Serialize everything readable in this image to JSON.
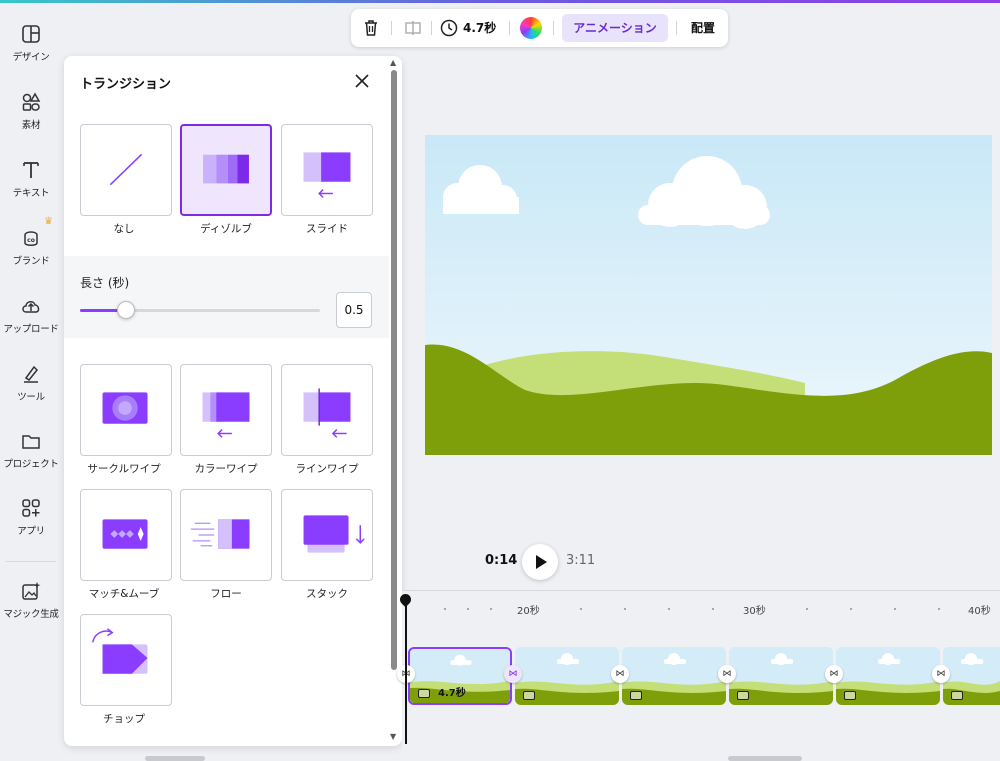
{
  "sidebar": {
    "items": [
      {
        "label": "デザイン",
        "icon": "layout-icon"
      },
      {
        "label": "素材",
        "icon": "shapes-icon"
      },
      {
        "label": "テキスト",
        "icon": "text-icon"
      },
      {
        "label": "ブランド",
        "icon": "brand-icon"
      },
      {
        "label": "アップロード",
        "icon": "cloud-upload-icon"
      },
      {
        "label": "ツール",
        "icon": "pen-tool-icon"
      },
      {
        "label": "プロジェクト",
        "icon": "folder-icon"
      },
      {
        "label": "アプリ",
        "icon": "apps-grid-icon"
      },
      {
        "label": "マジック生成",
        "icon": "magic-image-icon"
      }
    ]
  },
  "toolbar": {
    "duration": "4.7秒",
    "animation_label": "アニメーション",
    "position_label": "配置"
  },
  "panel": {
    "title": "トランジション",
    "duration_label": "長さ (秒)",
    "duration_value": "0.5",
    "duration_fraction": 0.19,
    "transitions": [
      {
        "label": "なし"
      },
      {
        "label": "ディゾルブ",
        "selected": true
      },
      {
        "label": "スライド"
      },
      {
        "label": "サークルワイプ"
      },
      {
        "label": "カラーワイプ"
      },
      {
        "label": "ラインワイプ"
      },
      {
        "label": "マッチ&ムーブ"
      },
      {
        "label": "フロー"
      },
      {
        "label": "スタック"
      },
      {
        "label": "チョップ"
      }
    ]
  },
  "playback": {
    "current_time": "0:14",
    "total_time": "3:11"
  },
  "timeline": {
    "ticks": [
      "20秒",
      "30秒",
      "40秒"
    ],
    "clips": [
      {
        "label": "4.7秒",
        "selected": true
      },
      {
        "label": ""
      },
      {
        "label": ""
      },
      {
        "label": ""
      },
      {
        "label": ""
      },
      {
        "label": ""
      }
    ]
  },
  "colors": {
    "accent": "#8b3dff",
    "sky": "#cfe9f8",
    "hill_dark": "#7f9f0a",
    "hill_light": "#c4de78"
  }
}
